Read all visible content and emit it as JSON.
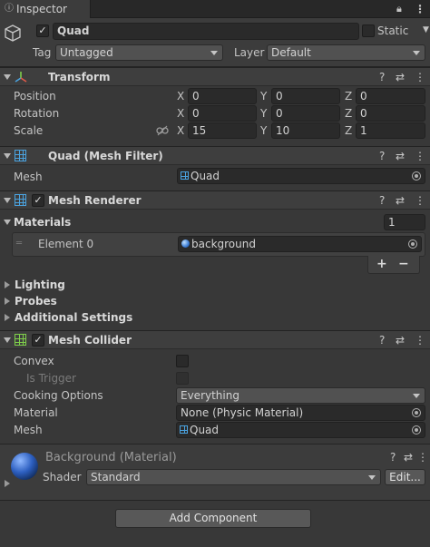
{
  "tab": {
    "title": "Inspector"
  },
  "object": {
    "name": "Quad",
    "static_label": "Static",
    "tag_label": "Tag",
    "tag_value": "Untagged",
    "layer_label": "Layer",
    "layer_value": "Default"
  },
  "transform": {
    "title": "Transform",
    "rows": [
      {
        "label": "Position",
        "x": "0",
        "y": "0",
        "z": "0"
      },
      {
        "label": "Rotation",
        "x": "0",
        "y": "0",
        "z": "0"
      },
      {
        "label": "Scale",
        "x": "15",
        "y": "10",
        "z": "1"
      }
    ],
    "axis_labels": {
      "x": "X",
      "y": "Y",
      "z": "Z"
    }
  },
  "mesh_filter": {
    "title": "Quad (Mesh Filter)",
    "mesh_label": "Mesh",
    "mesh_value": "Quad"
  },
  "mesh_renderer": {
    "title": "Mesh Renderer",
    "materials_label": "Materials",
    "materials_count": "1",
    "element_label": "Element 0",
    "element_value": "background",
    "add_label": "+",
    "remove_label": "−",
    "sections": [
      "Lighting",
      "Probes",
      "Additional Settings"
    ]
  },
  "mesh_collider": {
    "title": "Mesh Collider",
    "convex_label": "Convex",
    "trigger_label": "Is Trigger",
    "cooking_label": "Cooking Options",
    "cooking_value": "Everything",
    "material_label": "Material",
    "material_value": "None (Physic Material)",
    "mesh_label": "Mesh",
    "mesh_value": "Quad"
  },
  "material": {
    "title": "Background (Material)",
    "shader_label": "Shader",
    "shader_value": "Standard",
    "edit_label": "Edit..."
  },
  "footer": {
    "add_component_label": "Add Component"
  },
  "header_icons": {
    "help": "?",
    "presets": "⇄",
    "menu": "⋮"
  },
  "colors": {
    "background": "#383838",
    "header": "#3e3e3e",
    "field": "#2a2a2a",
    "accent_blue": "#4aa3e0",
    "accent_green": "#7fd04a"
  }
}
